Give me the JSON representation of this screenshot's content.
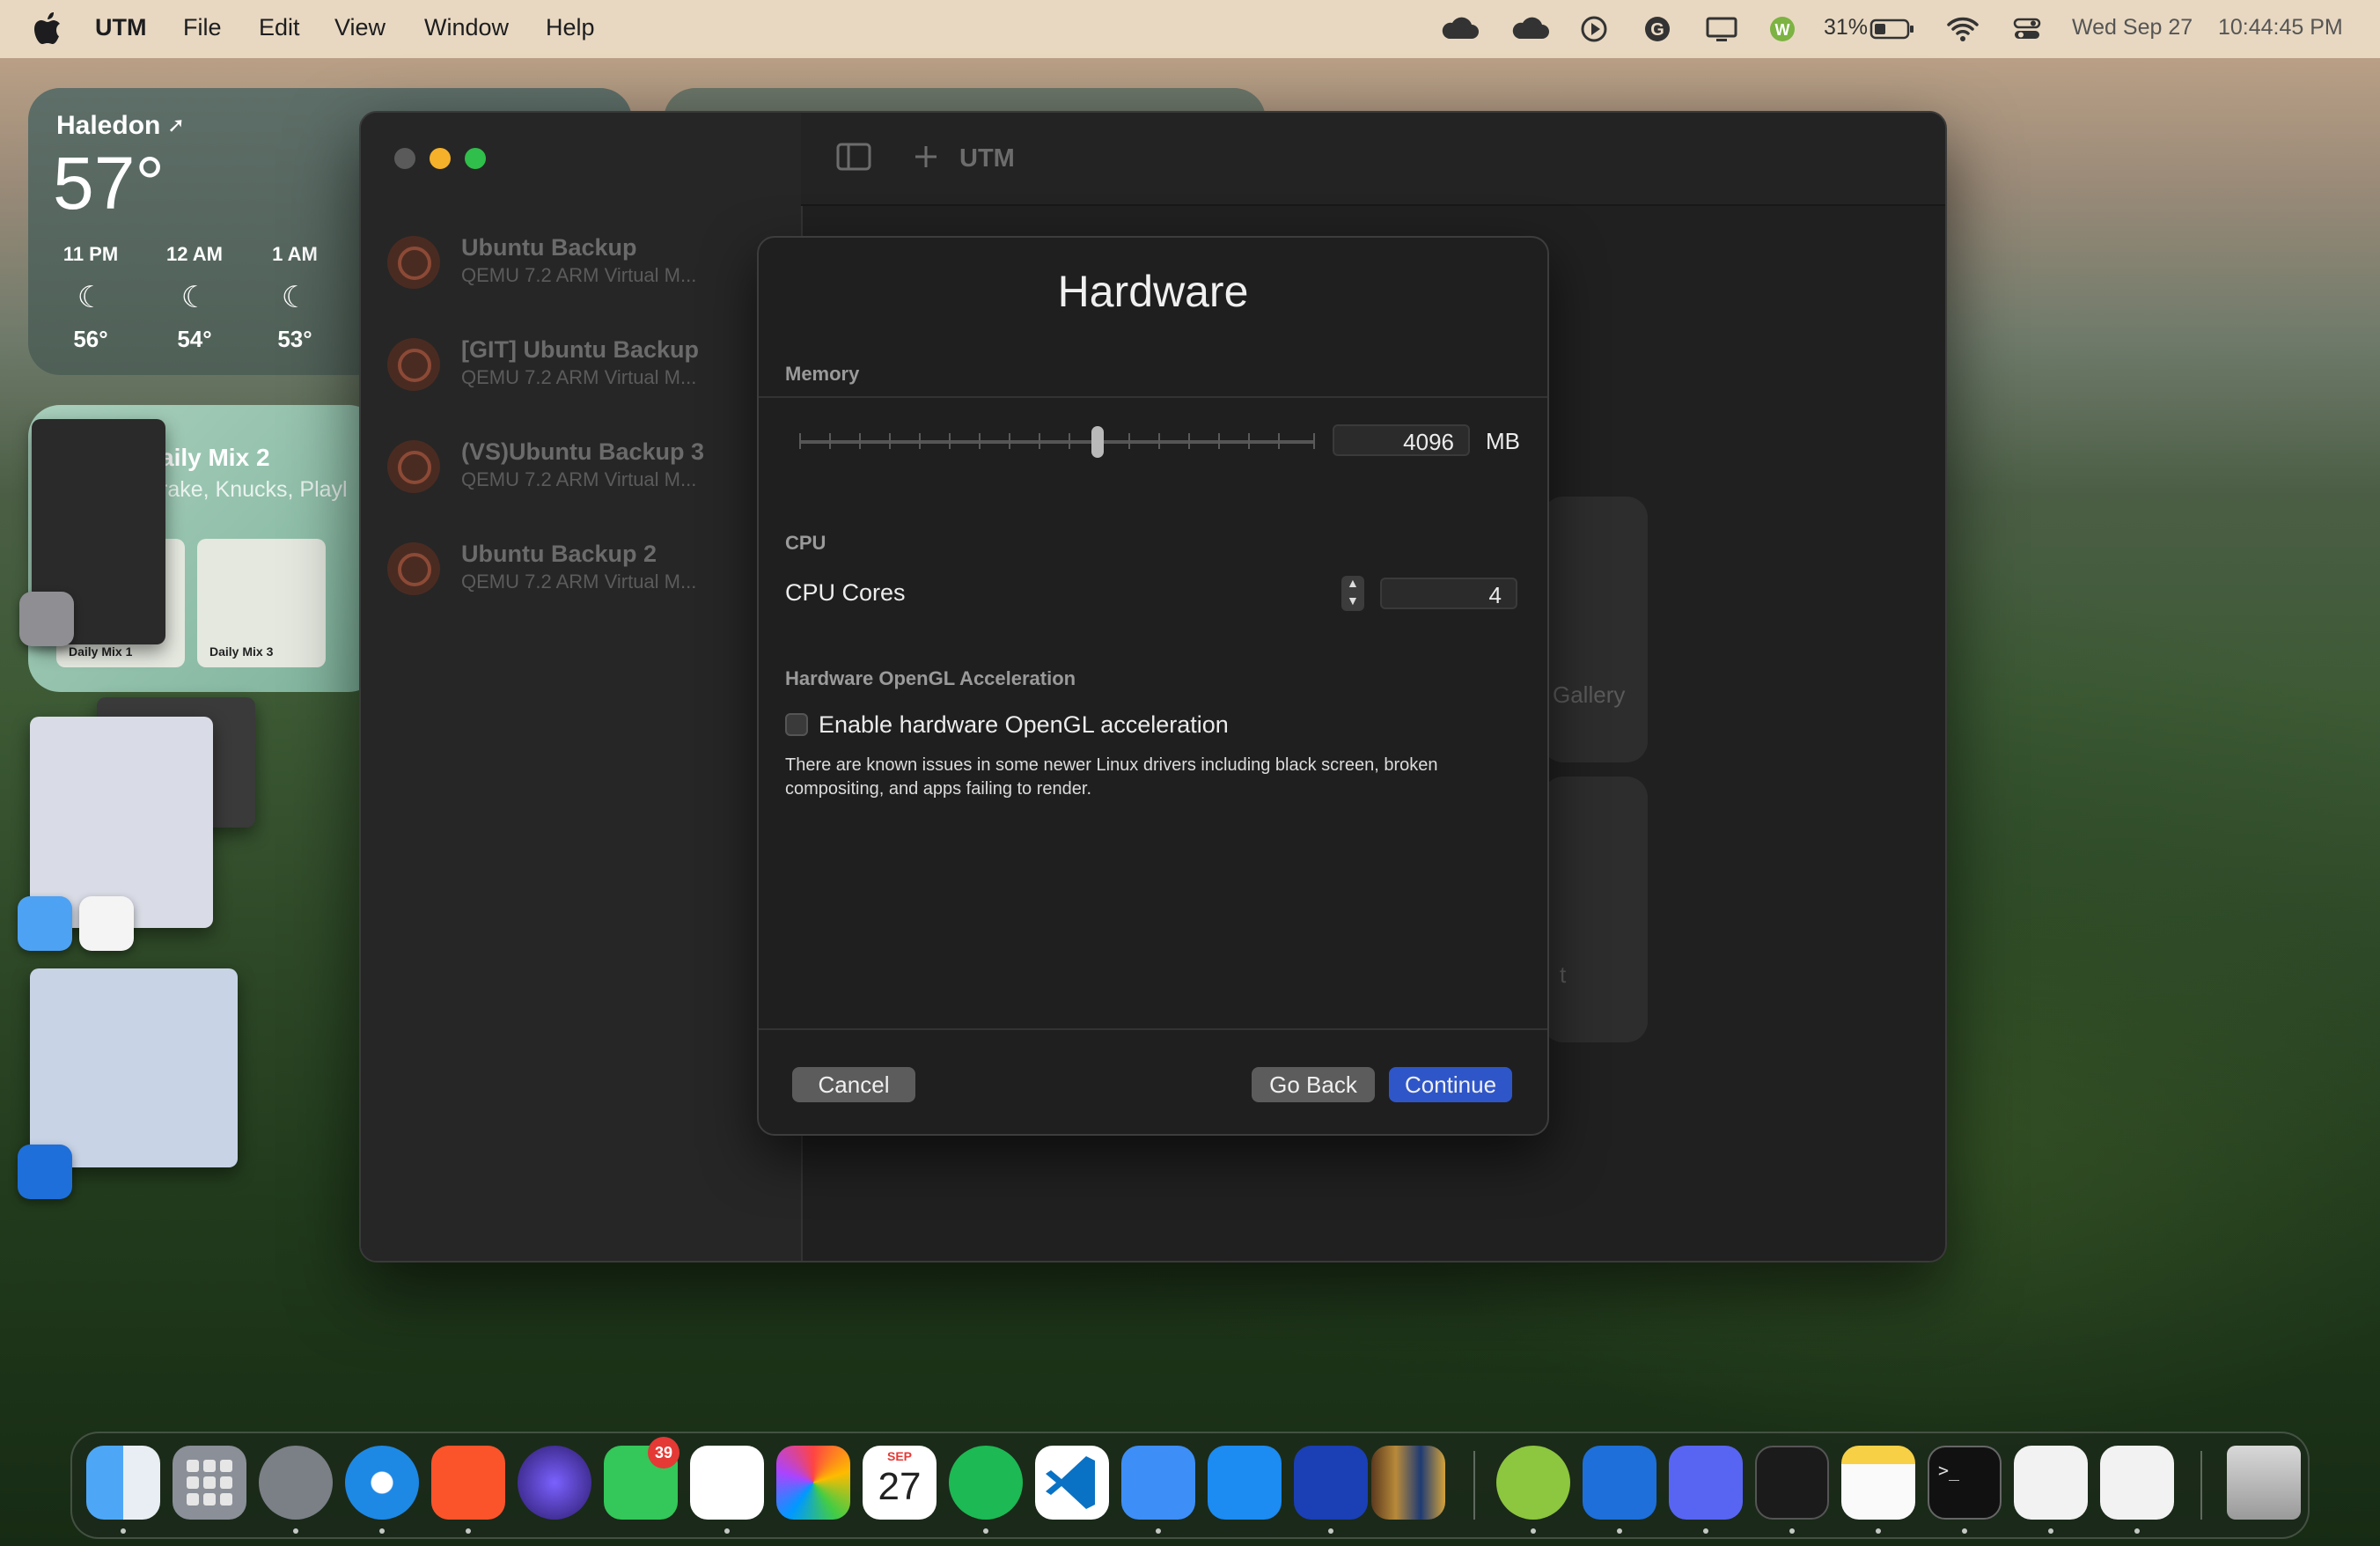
{
  "menubar": {
    "app_name": "UTM",
    "menus": [
      "File",
      "Edit",
      "View",
      "Window",
      "Help"
    ],
    "battery_percent": "31%",
    "date": "Wed Sep 27",
    "time": "10:44:45 PM"
  },
  "weather": {
    "city": "Haledon",
    "temperature": "57°",
    "hours": [
      {
        "time": "11 PM",
        "temp": "56°"
      },
      {
        "time": "12 AM",
        "temp": "54°"
      },
      {
        "time": "1 AM",
        "temp": "53°"
      }
    ]
  },
  "spotify_widget": {
    "title": "aily Mix 2",
    "subtitle": "rake, Knucks, Playl",
    "cards": [
      "Daily Mix 1",
      "Daily Mix 3"
    ]
  },
  "utm": {
    "toolbar_title": "UTM",
    "vms": [
      {
        "name": "Ubuntu Backup",
        "subtitle": "QEMU 7.2 ARM Virtual M..."
      },
      {
        "name": "[GIT] Ubuntu Backup",
        "subtitle": "QEMU 7.2 ARM Virtual M..."
      },
      {
        "name": "(VS)Ubuntu Backup 3",
        "subtitle": "QEMU 7.2 ARM Virtual M..."
      },
      {
        "name": "Ubuntu Backup 2",
        "subtitle": "QEMU 7.2 ARM Virtual M..."
      }
    ],
    "gallery_label": "Gallery",
    "card_fragment": "t"
  },
  "dialog": {
    "title": "Hardware",
    "memory_label": "Memory",
    "memory_value": "4096",
    "memory_unit": "MB",
    "cpu_section": "CPU",
    "cpu_cores_label": "CPU Cores",
    "cpu_cores_value": "4",
    "opengl_section": "Hardware OpenGL Acceleration",
    "opengl_checkbox_label": "Enable hardware OpenGL acceleration",
    "opengl_checked": false,
    "opengl_help": "There are known issues in some newer Linux drivers including black screen, broken compositing, and apps failing to render.",
    "cancel_label": "Cancel",
    "go_back_label": "Go Back",
    "continue_label": "Continue"
  },
  "dock": {
    "calendar_month": "SEP",
    "calendar_day": "27",
    "messages_badge": "39",
    "icons": [
      "finder-icon",
      "launchpad-icon",
      "system-settings-icon",
      "safari-icon",
      "brave-icon",
      "firefox-icon",
      "messages-icon",
      "slack-icon",
      "photos-icon",
      "calendar-icon",
      "spotify-icon",
      "vscode-icon",
      "xcode-icon",
      "app-store-icon",
      "vmware-icon",
      "calibre-icon",
      "w-app-icon",
      "outlook-icon",
      "discord-icon",
      "activity-monitor-icon",
      "notes-icon",
      "terminal-icon",
      "textedit-icon",
      "script-editor-icon",
      "trash-icon"
    ]
  },
  "colors": {
    "accent_blue": "#2f56c8",
    "traffic_close": "#5a5a5a",
    "traffic_min": "#f5b12a",
    "traffic_max": "#2fbf4a"
  }
}
